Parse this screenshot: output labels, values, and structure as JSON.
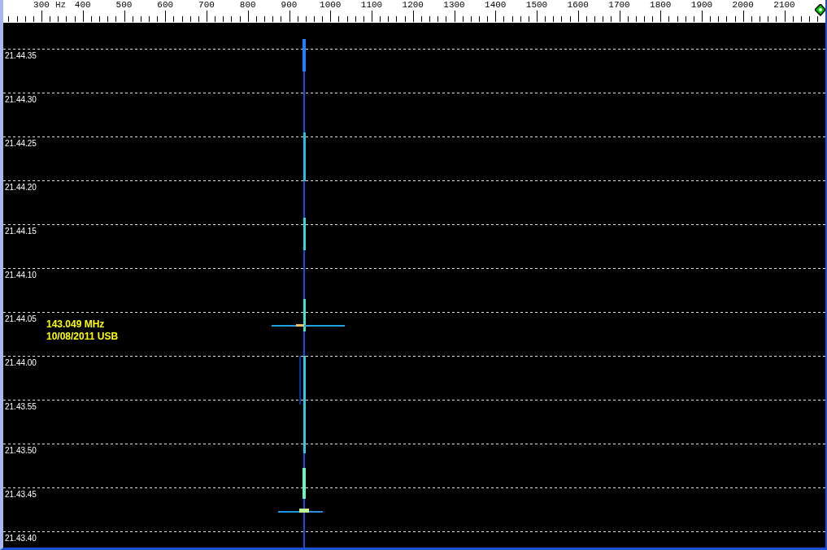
{
  "frequency_axis": {
    "unit": "Hz",
    "labels": [
      "300",
      "400",
      "500",
      "600",
      "700",
      "800",
      "900",
      "1000",
      "1100",
      "1200",
      "1300",
      "1400",
      "1500",
      "1600",
      "1700",
      "1800",
      "1900",
      "2000",
      "2100"
    ]
  },
  "time_labels": [
    "21.44.35",
    "21.44.30",
    "21.44.25",
    "21.44.20",
    "21.44.15",
    "21.44.10",
    "21.44.05",
    "21.44.00",
    "21.43.55",
    "21.43.50",
    "21.43.45",
    "21.43.40"
  ],
  "annotation": [
    "143.049 MHz",
    "10/08/2011 USB"
  ]
}
